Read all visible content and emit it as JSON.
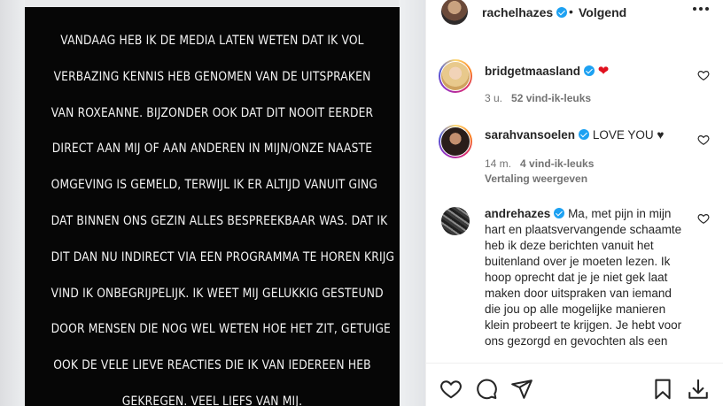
{
  "post": {
    "story_lines": [
      "VANDAAG HEB IK DE MEDIA LATEN WETEN DAT IK VOL",
      "VERBAZING KENNIS HEB GENOMEN VAN DE UITSPRAKEN",
      "VAN ROXEANNE. BIJZONDER OOK DAT DIT NOOIT EERDER",
      "DIRECT AAN MIJ  OF AAN ANDEREN IN MIJN/ONZE NAASTE",
      "OMGEVING IS GEMELD, TERWIJL IK ER ALTIJD VANUIT GING",
      "DAT BINNEN ONS GEZIN ALLES BESPREEKBAAR WAS. DAT IK",
      "DIT DAN NU INDIRECT VIA EEN PROGRAMMA TE HOREN KRIJG",
      "VIND IK ONBEGRIJPELIJK. IK WEET MIJ GELUKKIG GESTEUND",
      "DOOR MENSEN DIE NOG WEL WETEN HOE HET ZIT, GETUIGE",
      "OOK DE VELE LIEVE REACTIES DIE IK VAN IEDEREEN HEB",
      "GEKREGEN. VEEL LIEFS VAN MIJ."
    ]
  },
  "header": {
    "username": "rachelhazes",
    "separator": "•",
    "follow_label": "Volgend",
    "more_icon": "more-horizontal-icon"
  },
  "comments": [
    {
      "username": "bridgetmaasland",
      "verified": true,
      "text": "",
      "emoji": "❤",
      "time": "3 u.",
      "likes": "52 vind-ik-leuks",
      "translate": ""
    },
    {
      "username": "sarahvansoelen",
      "verified": true,
      "text": "LOVE YOU ♥",
      "time": "14 m.",
      "likes": "4 vind-ik-leuks",
      "translate": "Vertaling weergeven"
    },
    {
      "username": "andrehazes",
      "verified": true,
      "text": "Ma, met pijn in mijn hart en plaatsvervangende schaamte heb ik deze berichten vanuit het buitenland over je moeten lezen. Ik hoop oprecht dat je je niet gek laat maken door uitspraken van iemand die jou op alle mogelijke manieren klein probeert te krijgen. Je hebt voor ons gezorgd en gevochten als een"
    }
  ],
  "actions": [
    "heart-icon",
    "comment-icon",
    "share-icon",
    "bookmark-icon",
    "download-icon"
  ],
  "colors": {
    "verified": "#1da1f2",
    "heart": "#e0101e",
    "story_bg": "#060606"
  }
}
